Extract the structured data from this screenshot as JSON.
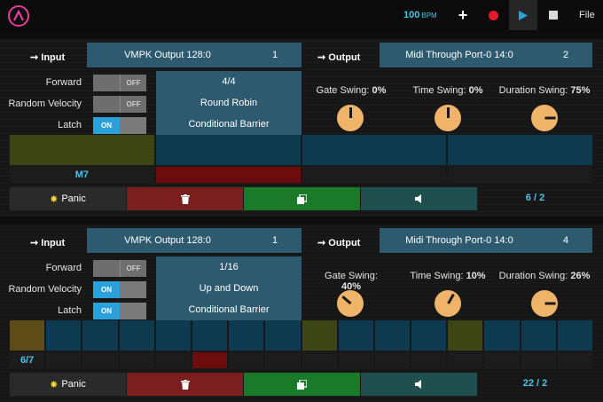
{
  "toolbar": {
    "bpm_value": "100",
    "bpm_unit": "BPM",
    "add_icon": "plus-icon",
    "record_icon": "record-icon",
    "play_icon": "play-icon",
    "stop_icon": "stop-icon",
    "file_label": "File",
    "colors": {
      "bpm": "#4fc3e8",
      "record": "#e8192c",
      "logo": "#e83d9c"
    }
  },
  "panels": [
    {
      "input_label": "Input",
      "input_port": "VMPK Output 128:0",
      "input_channel": "1",
      "output_label": "Output",
      "output_port": "Midi Through Port-0 14:0",
      "output_channel": "2",
      "rows": [
        {
          "label": "Forward",
          "toggle": "OFF",
          "on": false
        },
        {
          "label": "Random Velocity",
          "toggle": "OFF",
          "on": false
        },
        {
          "label": "Latch",
          "toggle": "ON",
          "on": true
        }
      ],
      "options": [
        "4/4",
        "Round Robin",
        "Conditional Barrier"
      ],
      "gate_swing": {
        "label": "Gate Swing:",
        "value": "0%",
        "angle": 0
      },
      "time_swing": {
        "label": "Time Swing:",
        "value": "0%",
        "angle": 0
      },
      "duration_swing": {
        "label": "Duration Swing:",
        "value": "75%",
        "angle": 90
      },
      "steps": [
        "olive",
        "teal",
        "teal",
        "teal"
      ],
      "sub_text": "M7",
      "sub_cells": [
        "empty",
        "red",
        "empty",
        "empty"
      ],
      "panic_label": "Panic",
      "trash_icon": "trash-icon",
      "copy_icon": "copy-icon",
      "speaker_icon": "speaker-icon",
      "counter": "6 / 2"
    },
    {
      "input_label": "Input",
      "input_port": "VMPK Output 128:0",
      "input_channel": "1",
      "output_label": "Output",
      "output_port": "Midi Through Port-0 14:0",
      "output_channel": "4",
      "rows": [
        {
          "label": "Forward",
          "toggle": "OFF",
          "on": false
        },
        {
          "label": "Random Velocity",
          "toggle": "ON",
          "on": true
        },
        {
          "label": "Latch",
          "toggle": "ON",
          "on": true
        }
      ],
      "options": [
        "1/16",
        "Up and Down",
        "Conditional Barrier"
      ],
      "gate_swing": {
        "label": "Gate Swing:",
        "value": "40%",
        "angle": -50
      },
      "time_swing": {
        "label": "Time Swing:",
        "value": "10%",
        "angle": 30
      },
      "duration_swing": {
        "label": "Duration Swing:",
        "value": "26%",
        "angle": 90
      },
      "steps": [
        "gold",
        "teal",
        "teal",
        "teal",
        "teal",
        "teal",
        "teal",
        "teal",
        "olive",
        "teal",
        "teal",
        "teal",
        "olive",
        "teal",
        "teal",
        "teal"
      ],
      "sub_text": "6/7",
      "sub_cells": [
        "empty",
        "empty",
        "empty",
        "empty",
        "empty",
        "red",
        "empty",
        "empty",
        "empty",
        "empty",
        "empty",
        "empty",
        "empty",
        "empty",
        "empty",
        "empty"
      ],
      "panic_label": "Panic",
      "trash_icon": "trash-icon",
      "copy_icon": "copy-icon",
      "speaker_icon": "speaker-icon",
      "counter": "22 / 2"
    }
  ],
  "step_colors": {
    "olive": "#3d4514",
    "teal": "#0e3a4f",
    "gold": "#5e4c18",
    "red": "#6b0d0d",
    "empty": "#1c1c1c"
  }
}
